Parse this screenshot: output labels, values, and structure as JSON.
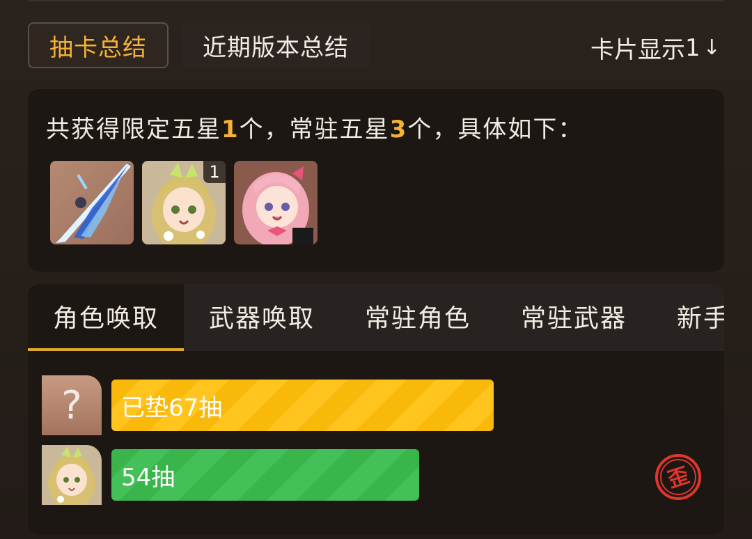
{
  "header": {
    "tabs": [
      "抽卡总结",
      "近期版本总结"
    ],
    "card_display": "卡片显示",
    "card_display_num": "1"
  },
  "summary": {
    "prefix": "共获得限定五星",
    "limited_count": "1",
    "middle": "个，常驻五星",
    "standard_count": "3",
    "suffix": "个，具体如下："
  },
  "obtained_items": [
    {
      "icon": "weapon-sword-thumbnail",
      "count": ""
    },
    {
      "icon": "character-green-hair-thumbnail",
      "count": "1"
    },
    {
      "icon": "character-pink-hair-thumbnail",
      "count": ""
    }
  ],
  "pool_tabs": [
    "角色唤取",
    "武器唤取",
    "常驻角色",
    "常驻武器",
    "新手"
  ],
  "active_pool_tab": 0,
  "records": [
    {
      "avatar": "unknown-question-icon",
      "label": "已垫67抽",
      "color": "#f9b90a",
      "pulls": 67
    },
    {
      "avatar": "character-green-hair-thumbnail",
      "label": "54抽",
      "color": "#3ab54c",
      "pulls": 54,
      "badge": "歪",
      "badge_color": "#e0362c"
    }
  ]
}
